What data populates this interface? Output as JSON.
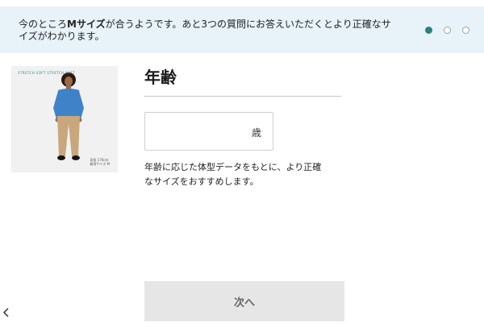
{
  "banner": {
    "message_before": "今のところ",
    "message_size": "Mサイズ",
    "message_after": "が合うようです。あと3つの質問にお答えいただくとより正確なサイズがわかります。",
    "step_current": 1,
    "step_total": 3
  },
  "product_image": {
    "tag_text": "STRETCH SOFT STRETCH SOFT",
    "caption_line1": "身長 170cm",
    "caption_line2": "着用サイズ M"
  },
  "question": {
    "title": "年齢",
    "input_value": "",
    "input_placeholder": "",
    "unit": "歳",
    "description": "年齢に応じた体型データをもとに、より正確なサイズをおすすめします。"
  },
  "actions": {
    "next_label": "次へ",
    "back_icon": "chevron-left-icon"
  },
  "colors": {
    "banner_bg": "#e8f2f9",
    "active_dot": "#2f7f80",
    "button_bg": "#e6e6e6"
  }
}
